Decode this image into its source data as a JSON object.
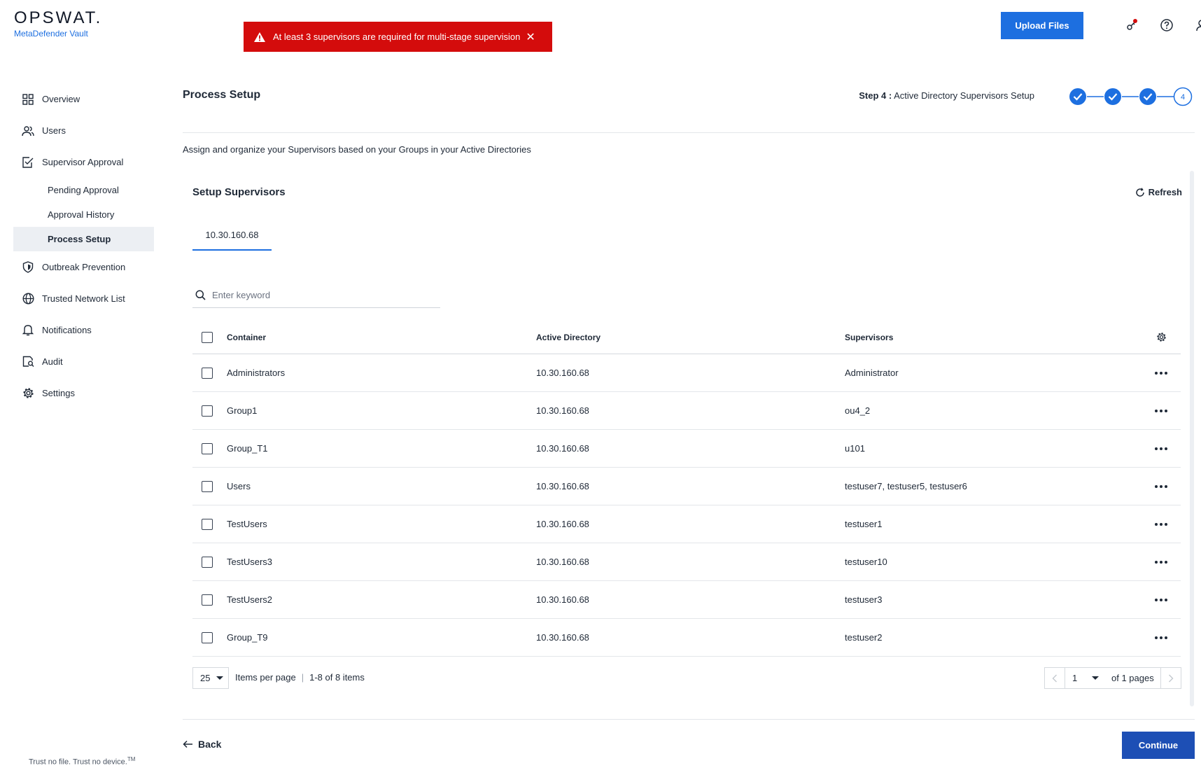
{
  "brand": {
    "logo_text": "OPSWAT.",
    "product": "MetaDefender Vault",
    "tagline": "Trust no file. Trust no device.",
    "tagline_mark": "TM"
  },
  "toast": {
    "message": "At least 3 supervisors are required for multi-stage supervision",
    "close": "✕",
    "color": "#d40c0c"
  },
  "topbar": {
    "upload_label": "Upload Files",
    "icons": [
      "notification-key-icon",
      "help-icon",
      "user-icon"
    ]
  },
  "sidebar": {
    "items": [
      {
        "label": "Overview",
        "icon": "grid-icon"
      },
      {
        "label": "Users",
        "icon": "users-icon"
      },
      {
        "label": "Supervisor Approval",
        "icon": "approval-icon"
      },
      {
        "label": "Outbreak Prevention",
        "icon": "shield-icon"
      },
      {
        "label": "Trusted Network List",
        "icon": "globe-icon"
      },
      {
        "label": "Notifications",
        "icon": "bell-icon"
      },
      {
        "label": "Audit",
        "icon": "audit-icon"
      },
      {
        "label": "Settings",
        "icon": "gear-icon"
      }
    ],
    "sub_items": [
      {
        "label": "Pending Approval"
      },
      {
        "label": "Approval History"
      },
      {
        "label": "Process Setup",
        "active": true
      }
    ]
  },
  "header": {
    "title": "Process Setup",
    "step_prefix": "Step 4 :",
    "step_name": "Active Directory Supervisors Setup",
    "steps_total": 4,
    "current_step": 4,
    "current_step_label": "4"
  },
  "main": {
    "description": "Assign and organize your Supervisors based on your Groups in your Active Directories",
    "section_title": "Setup Supervisors",
    "refresh_label": "Refresh",
    "tab_label": "10.30.160.68",
    "search_placeholder": "Enter keyword"
  },
  "table": {
    "columns": [
      "Container",
      "Active Directory",
      "Supervisors"
    ],
    "rows": [
      {
        "container": "Administrators",
        "ad": "10.30.160.68",
        "supervisors": "Administrator"
      },
      {
        "container": "Group1",
        "ad": "10.30.160.68",
        "supervisors": "ou4_2"
      },
      {
        "container": "Group_T1",
        "ad": "10.30.160.68",
        "supervisors": "u101"
      },
      {
        "container": "Users",
        "ad": "10.30.160.68",
        "supervisors": "testuser7, testuser5, testuser6"
      },
      {
        "container": "TestUsers",
        "ad": "10.30.160.68",
        "supervisors": "testuser1"
      },
      {
        "container": "TestUsers3",
        "ad": "10.30.160.68",
        "supervisors": "testuser10"
      },
      {
        "container": "TestUsers2",
        "ad": "10.30.160.68",
        "supervisors": "testuser3"
      },
      {
        "container": "Group_T9",
        "ad": "10.30.160.68",
        "supervisors": "testuser2"
      }
    ]
  },
  "pagination": {
    "page_size": "25",
    "per_page_label": "Items per page",
    "range_label": "1-8 of 8 items",
    "current_page": "1",
    "of_pages_label": "of 1 pages"
  },
  "footer": {
    "back_label": "Back",
    "continue_label": "Continue"
  },
  "colors": {
    "accent": "#1d6fe0",
    "continue": "#1d4fb5",
    "error": "#d40c0c"
  }
}
